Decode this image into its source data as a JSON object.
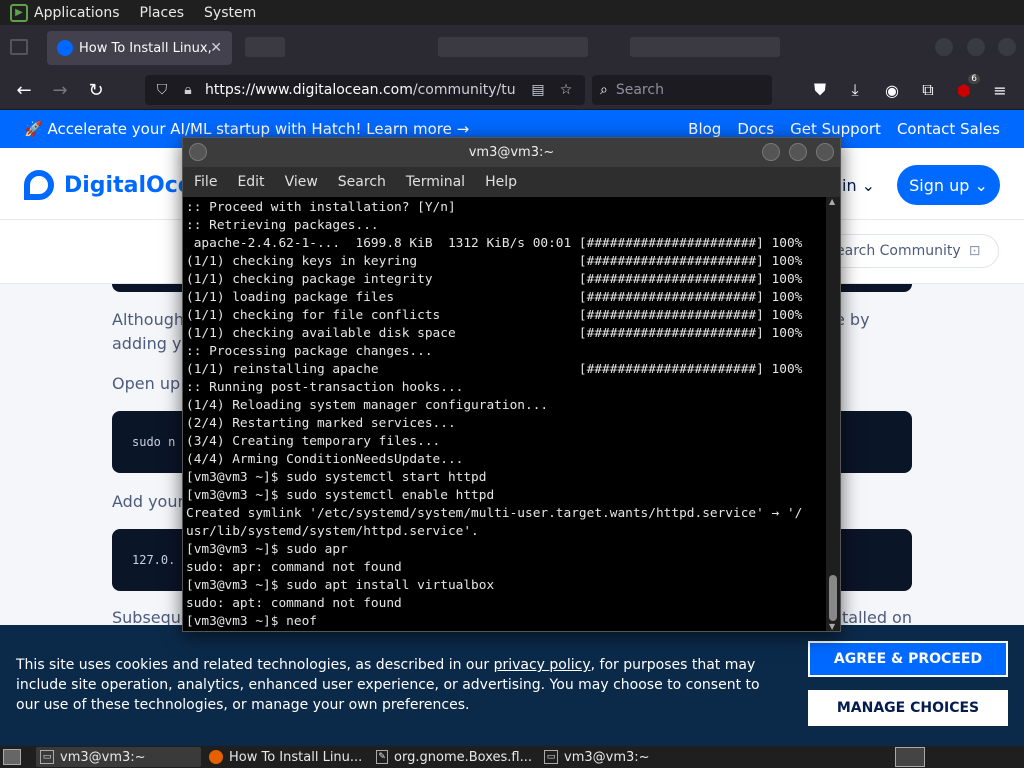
{
  "panel": {
    "menus": [
      "Applications",
      "Places",
      "System"
    ]
  },
  "browser": {
    "active_tab_title": "How To Install Linux,",
    "url_host": "https://www.digitalocean.com",
    "url_path": "/community/tutoria",
    "search_placeholder": "Search",
    "notification_badge": "6"
  },
  "page": {
    "banner_promo": "🚀 Accelerate your AI/ML startup with Hatch! Learn more →",
    "banner_links": [
      "Blog",
      "Docs",
      "Get Support",
      "Contact Sales"
    ],
    "logo_text": "DigitalOcean",
    "login_label": "in ⌄",
    "signup_label": "Sign up ⌄",
    "community_search": "earch Community",
    "para1_left_a": "Although",
    "para1_left_b": "adding yo",
    "para1_right": "e by",
    "para2_left": "Open up",
    "code1_text": "sudo n",
    "para3_left": "Add your",
    "code2_text": "127.0.",
    "para4_left": "Subseque",
    "para4_right": "talled on"
  },
  "cookie": {
    "text_before_link": "This site uses cookies and related technologies, as described in our ",
    "link_text": "privacy policy",
    "text_after_link": ", for purposes that may include site operation, analytics, enhanced user experience, or advertising. You may choose to consent to our use of these technologies, or manage your own preferences.",
    "agree_label": "AGREE & PROCEED",
    "manage_label": "MANAGE CHOICES"
  },
  "terminal": {
    "title": "vm3@vm3:~",
    "menus": [
      "File",
      "Edit",
      "View",
      "Search",
      "Terminal",
      "Help"
    ],
    "lines": [
      ":: Proceed with installation? [Y/n]",
      ":: Retrieving packages...",
      " apache-2.4.62-1-...  1699.8 KiB  1312 KiB/s 00:01 [######################] 100%",
      "(1/1) checking keys in keyring                     [######################] 100%",
      "(1/1) checking package integrity                   [######################] 100%",
      "(1/1) loading package files                        [######################] 100%",
      "(1/1) checking for file conflicts                  [######################] 100%",
      "(1/1) checking available disk space                [######################] 100%",
      ":: Processing package changes...",
      "(1/1) reinstalling apache                          [######################] 100%",
      ":: Running post-transaction hooks...",
      "(1/4) Reloading system manager configuration...",
      "(2/4) Restarting marked services...",
      "(3/4) Creating temporary files...",
      "(4/4) Arming ConditionNeedsUpdate...",
      "[vm3@vm3 ~]$ sudo systemctl start httpd",
      "[vm3@vm3 ~]$ sudo systemctl enable httpd",
      "Created symlink '/etc/systemd/system/multi-user.target.wants/httpd.service' → '/",
      "usr/lib/systemd/system/httpd.service'.",
      "[vm3@vm3 ~]$ sudo apr",
      "sudo: apr: command not found",
      "[vm3@vm3 ~]$ sudo apt install virtualbox",
      "sudo: apt: command not found",
      "[vm3@vm3 ~]$ neof"
    ]
  },
  "taskbar": {
    "tasks": [
      "vm3@vm3:~",
      "How To Install Linu...",
      "org.gnome.Boxes.fl...",
      "vm3@vm3:~"
    ]
  }
}
